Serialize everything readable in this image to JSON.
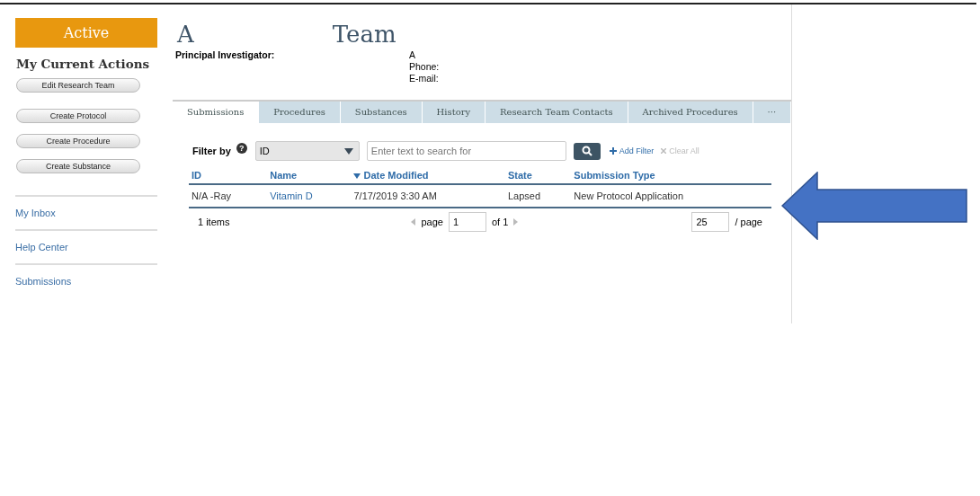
{
  "status_badge": "Active",
  "actions": {
    "title": "My Current Actions",
    "buttons": [
      "Edit Research Team",
      "Create Protocol",
      "Create Procedure",
      "Create Substance"
    ]
  },
  "nav_links": [
    "My Inbox",
    "Help Center",
    "Submissions"
  ],
  "header": {
    "title_start": "A",
    "title_end": "Team",
    "pi_label": "Principal Investigator:",
    "pi_name": "A",
    "pi_phone": "Phone:",
    "pi_email": "E-mail:"
  },
  "tabs": [
    {
      "label": "Submissions",
      "selected": true
    },
    {
      "label": "Procedures",
      "selected": false
    },
    {
      "label": "Substances",
      "selected": false
    },
    {
      "label": "History",
      "selected": false
    },
    {
      "label": "Research Team Contacts",
      "selected": false
    },
    {
      "label": "Archived Procedures",
      "selected": false
    },
    {
      "label": "···",
      "selected": false
    }
  ],
  "filter": {
    "label": "Filter by",
    "help": "?",
    "field": "ID",
    "placeholder": "Enter text to search for",
    "add": "Add Filter",
    "clear": "Clear All"
  },
  "table": {
    "columns": [
      {
        "label": "ID",
        "sorted": false
      },
      {
        "label": "Name",
        "sorted": false
      },
      {
        "label": "Date Modified",
        "sorted": true
      },
      {
        "label": "State",
        "sorted": false
      },
      {
        "label": "Submission Type",
        "sorted": false
      }
    ],
    "rows": [
      [
        "N/A -Ray",
        "Vitamin D",
        "7/17/2019 3:30 AM",
        "Lapsed",
        "New Protocol Application"
      ]
    ]
  },
  "pager": {
    "count": "1 items",
    "page_label": "page",
    "page": "1",
    "of": "of 1",
    "per_page": "25",
    "per_page_label": "/ page"
  }
}
